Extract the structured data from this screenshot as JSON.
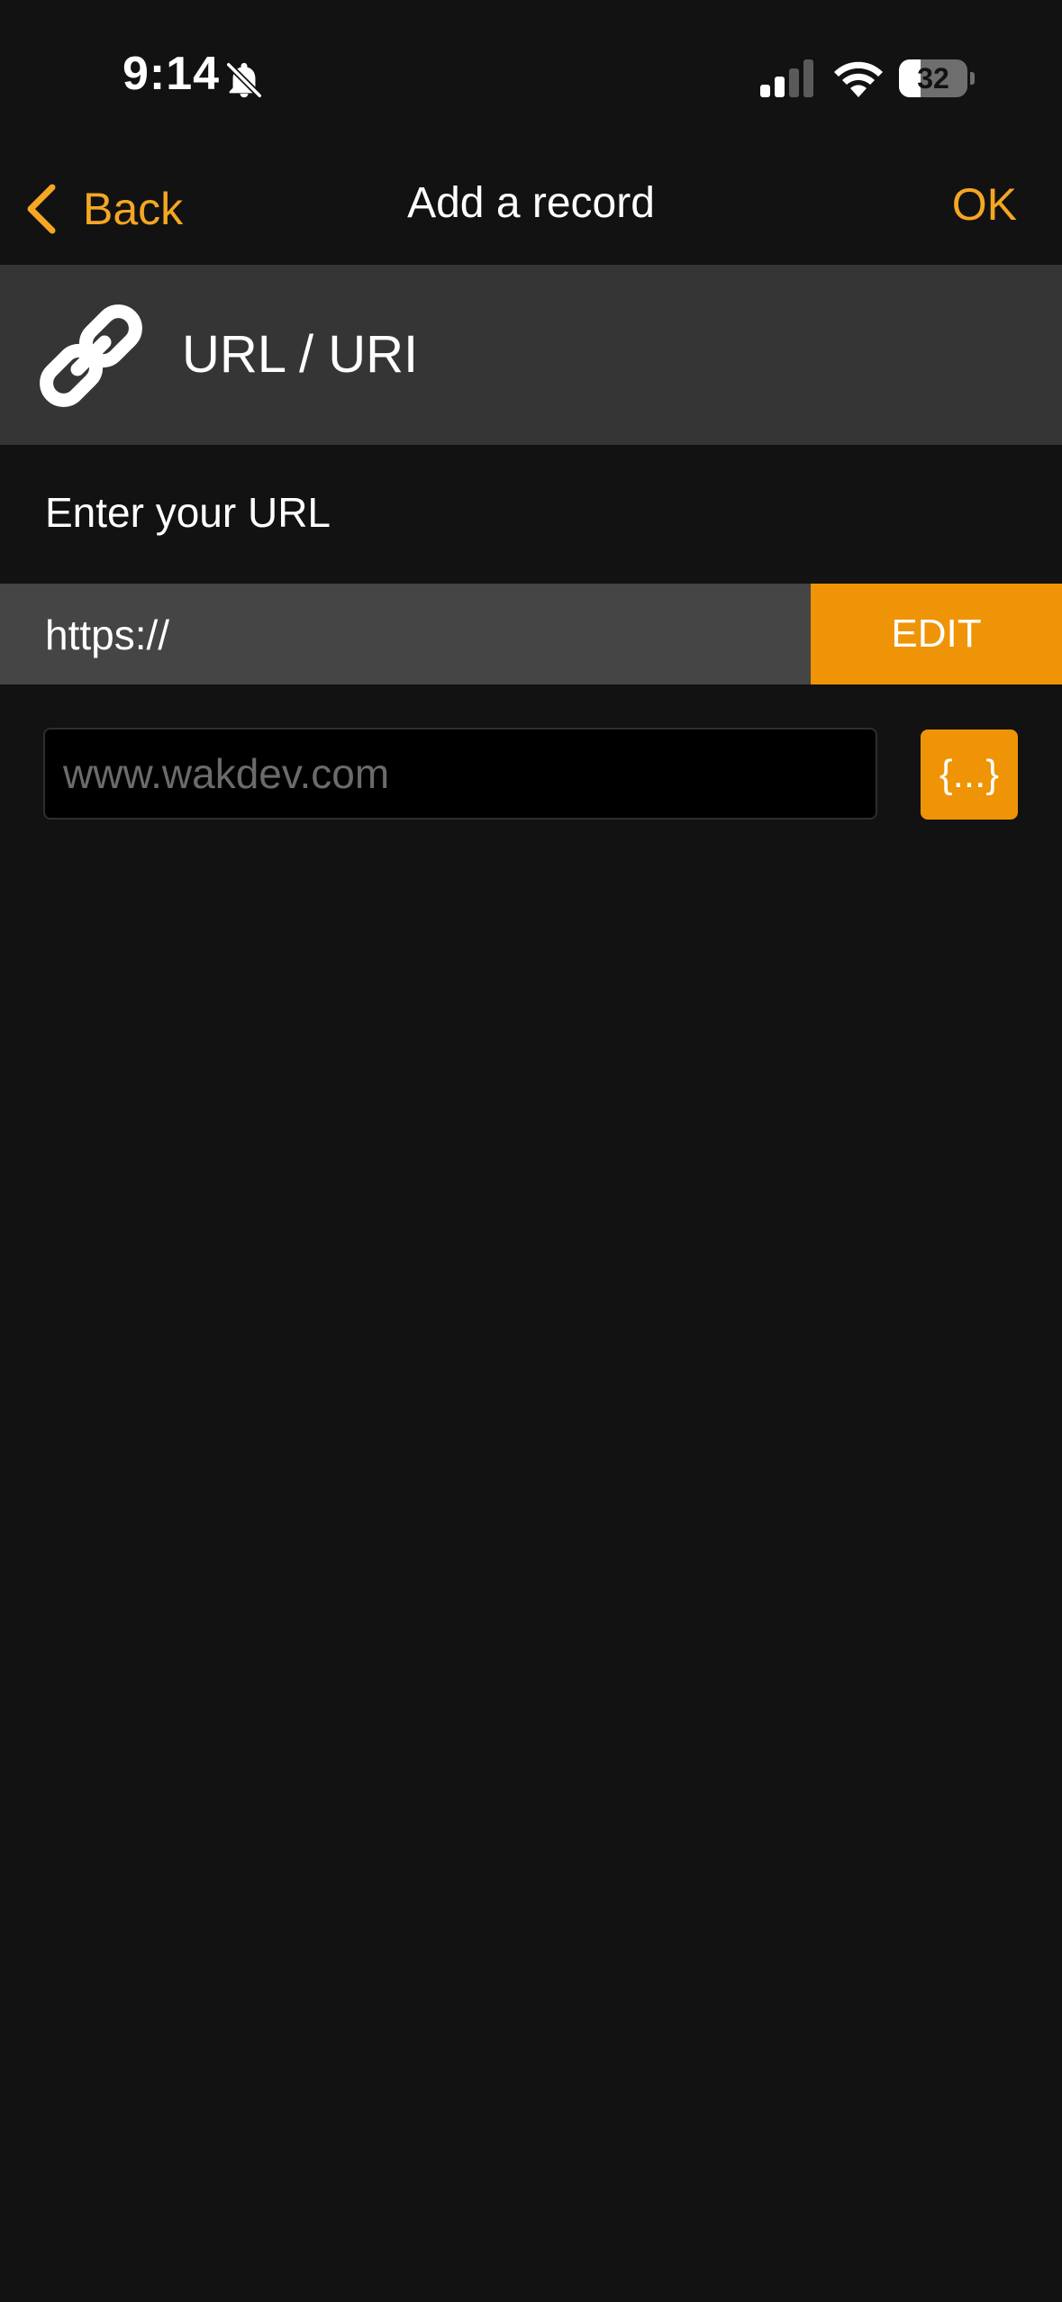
{
  "status_bar": {
    "time": "9:14",
    "battery_level": "32",
    "battery_fraction": 0.32,
    "icons": [
      "bell-slash-icon",
      "cellular-signal-icon",
      "wifi-icon",
      "battery-icon"
    ]
  },
  "nav": {
    "back_label": "Back",
    "title": "Add a record",
    "ok_label": "OK"
  },
  "record": {
    "icon": "link-icon",
    "type_label": "URL / URI"
  },
  "form": {
    "prompt": "Enter your URL",
    "prefix": "https://",
    "edit_label": "EDIT",
    "url_placeholder": "www.wakdev.com",
    "url_value": "",
    "variables_label": "{...}"
  },
  "colors": {
    "accent": "#f5a623",
    "button_orange": "#ef9406",
    "background": "#121212",
    "header_gray": "#353535",
    "prefix_gray": "#454545"
  }
}
